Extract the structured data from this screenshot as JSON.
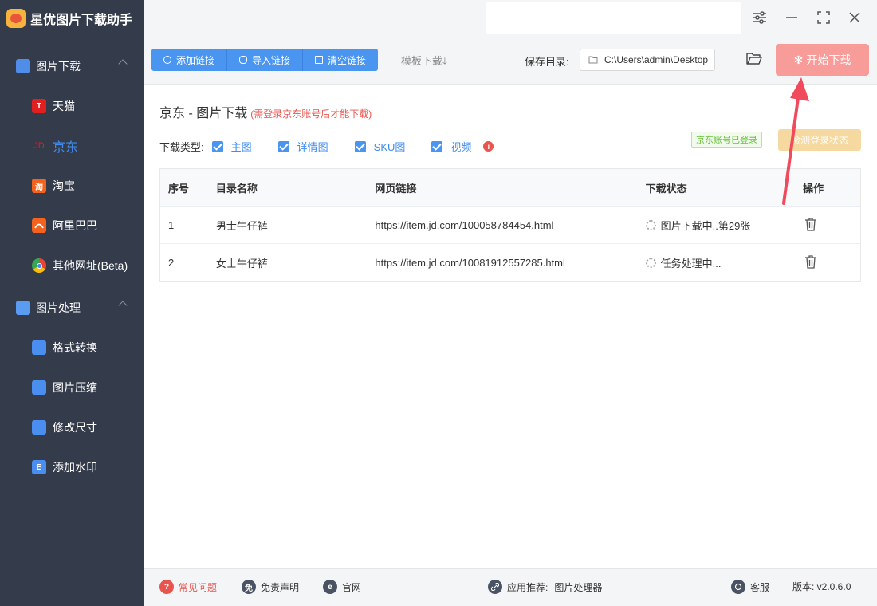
{
  "app": {
    "title": "星优图片下载助手"
  },
  "sidebar": {
    "group_download": {
      "label": "图片下载"
    },
    "download_items": [
      {
        "label": "天猫",
        "icon": "tmall-icon"
      },
      {
        "label": "京东",
        "icon": "jd-icon"
      },
      {
        "label": "淘宝",
        "icon": "taobao-icon"
      },
      {
        "label": "阿里巴巴",
        "icon": "alibaba-icon"
      },
      {
        "label": "其他网址(Beta)",
        "icon": "chrome-icon"
      }
    ],
    "group_process": {
      "label": "图片处理"
    },
    "process_items": [
      {
        "label": "格式转换"
      },
      {
        "label": "图片压缩"
      },
      {
        "label": "修改尺寸"
      },
      {
        "label": "添加水印"
      }
    ],
    "icon_glyphs": {
      "tmall": "T",
      "jd": "JD",
      "taobao": "淘",
      "watermark": "E"
    }
  },
  "toolbar": {
    "add_link": "添加链接",
    "import_link": "导入链接",
    "clear_link": "清空链接",
    "template_download": "模板下载",
    "template_arrow": "⤓",
    "save_dir_label": "保存目录:",
    "save_dir_value": "C:\\Users\\admin\\Desktop",
    "start_download": "开始下载",
    "start_icon": "✻"
  },
  "main": {
    "title": "京东 - 图片下载",
    "subtitle": "(需登录京东账号后才能下载)",
    "download_type_label": "下载类型:",
    "types": [
      "主图",
      "详情图",
      "SKU图",
      "视频"
    ],
    "info_glyph": "i",
    "logged_in_badge": "京东账号已登录",
    "check_login_button": "检测登录状态"
  },
  "table": {
    "headers": [
      "序号",
      "目录名称",
      "网页链接",
      "下载状态",
      "操作"
    ],
    "rows": [
      {
        "index": "1",
        "name": "男士牛仔裤",
        "url": "https://item.jd.com/100058784454.html",
        "status": "图片下载中..第29张"
      },
      {
        "index": "2",
        "name": "女士牛仔裤",
        "url": "https://item.jd.com/10081912557285.html",
        "status": "任务处理中..."
      }
    ]
  },
  "footer": {
    "faq": "常见问题",
    "disclaimer": "免责声明",
    "website": "官网",
    "recommend_label": "应用推荐:",
    "recommend_app": "图片处理器",
    "support": "客服",
    "version": "版本: v2.0.6.0",
    "icon_glyphs": {
      "faq": "?",
      "disclaimer": "免",
      "website": "e"
    }
  },
  "colors": {
    "primary": "#4a95f0",
    "sidebar_bg": "#343b4a",
    "start_button": "#f89c9a",
    "danger": "#e8554f"
  }
}
